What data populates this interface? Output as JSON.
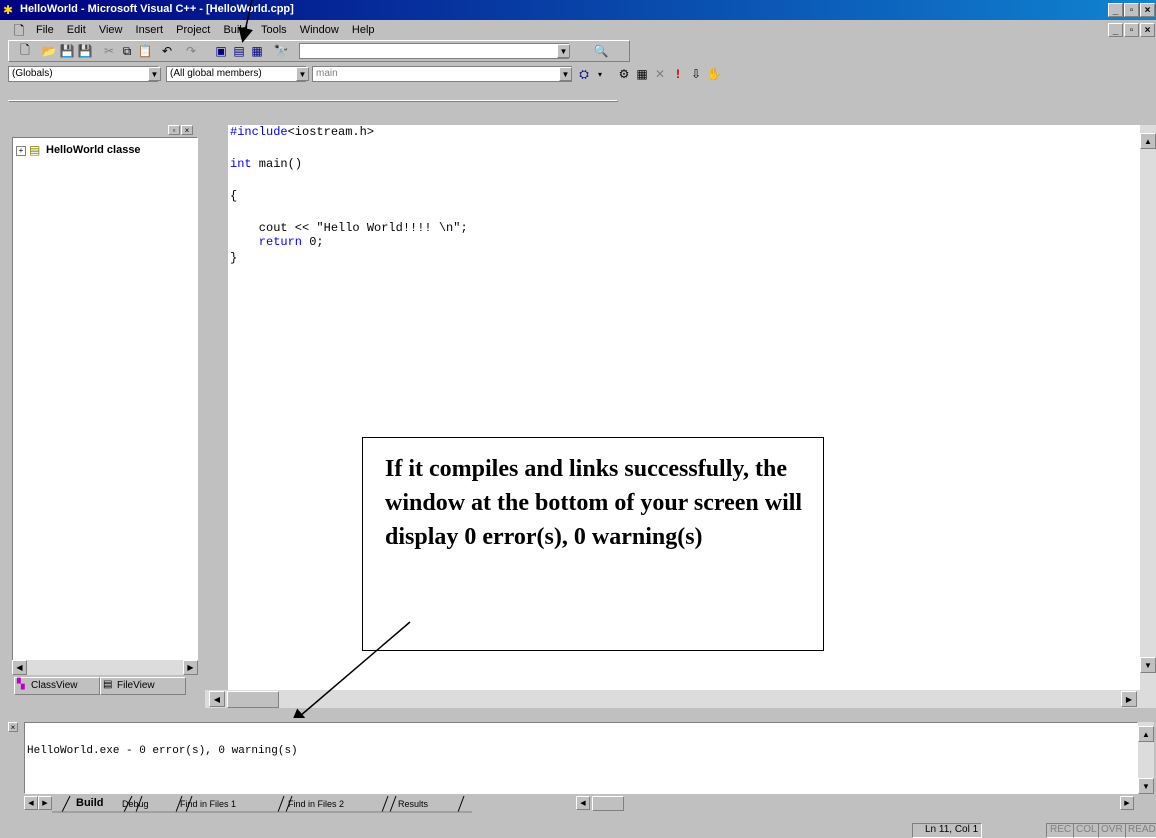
{
  "titlebar": {
    "title": "HelloWorld - Microsoft Visual C++ - [HelloWorld.cpp]"
  },
  "menu": [
    "File",
    "Edit",
    "View",
    "Insert",
    "Project",
    "Build",
    "Tools",
    "Window",
    "Help"
  ],
  "wizard": {
    "scope": "(Globals)",
    "members": "(All global members)",
    "function": "main"
  },
  "workspace": {
    "tree_root": "HelloWorld classe",
    "tabs": [
      "ClassView",
      "FileView"
    ]
  },
  "code": {
    "include_kw": "#include",
    "include_rest": "<iostream.h>",
    "main_kw": "int",
    "main_rest": " main()",
    "open_brace": "{",
    "cout_line": "    cout << \"Hello World!!!! \\n\";",
    "return_kw": "    return",
    "return_rest": " 0;",
    "close_brace": "}"
  },
  "callout": {
    "text": "If it compiles and links successfully, the window at the bottom of your screen will display 0 error(s), 0 warning(s)"
  },
  "output": {
    "text": "HelloWorld.exe - 0 error(s), 0 warning(s)",
    "tabs": [
      "Build",
      "Debug",
      "Find in Files 1",
      "Find in Files 2",
      "Results"
    ]
  },
  "status": {
    "position": "Ln 11, Col 1",
    "indicators": [
      "REC",
      "COL",
      "OVR",
      "READ"
    ]
  },
  "colors": {
    "title_start": "#000080",
    "title_end": "#1084d0",
    "keyword": "#0000ff",
    "disabled": "#808080"
  }
}
